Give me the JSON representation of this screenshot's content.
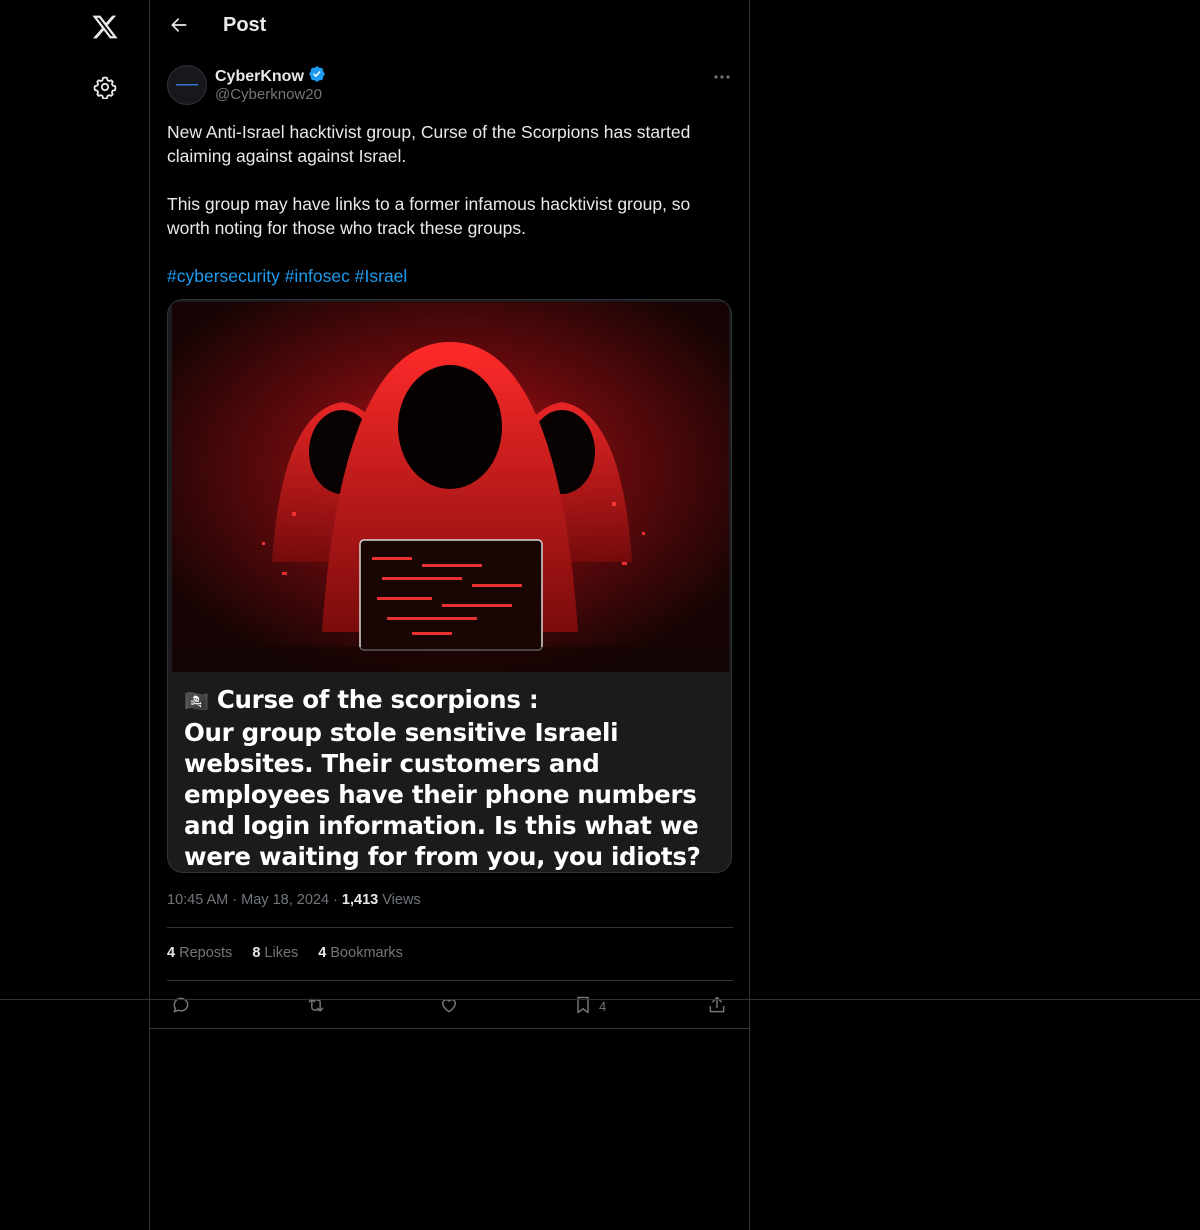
{
  "nav": {
    "logo_icon": "x-logo-icon",
    "settings_icon": "gear-icon"
  },
  "header": {
    "back_icon": "arrow-left-icon",
    "title": "Post"
  },
  "post": {
    "author": {
      "name": "CyberKnow",
      "handle": "@Cyberknow20",
      "verified": true
    },
    "paragraphs": [
      "New Anti-Israel hacktivist group, Curse of the Scorpions has started claiming against against Israel.",
      "This group may have links to a former infamous hacktivist group, so worth noting for those who track these groups."
    ],
    "hashtags": [
      "#cybersecurity",
      "#infosec",
      "#Israel"
    ],
    "media": {
      "caption_title": "Curse of the scorpions :",
      "caption_body": "Our group stole sensitive Israeli websites. Their customers and employees have their phone numbers and login information. Is this what we were waiting for from you, you idiots? Stay tuned for our attacks."
    },
    "time": "10:45 AM",
    "date": "May 18, 2024",
    "views_count": "1,413",
    "views_label": "Views",
    "stats": {
      "reposts_count": "4",
      "reposts_label": "Reposts",
      "likes_count": "8",
      "likes_label": "Likes",
      "bookmarks_count": "4",
      "bookmarks_label": "Bookmarks"
    },
    "actions": {
      "bookmark_count": "4"
    }
  },
  "colors": {
    "accent": "#1d9bf0",
    "muted": "#71767b",
    "text": "#e7e9ea",
    "border": "#2f3336",
    "background": "#000000"
  }
}
